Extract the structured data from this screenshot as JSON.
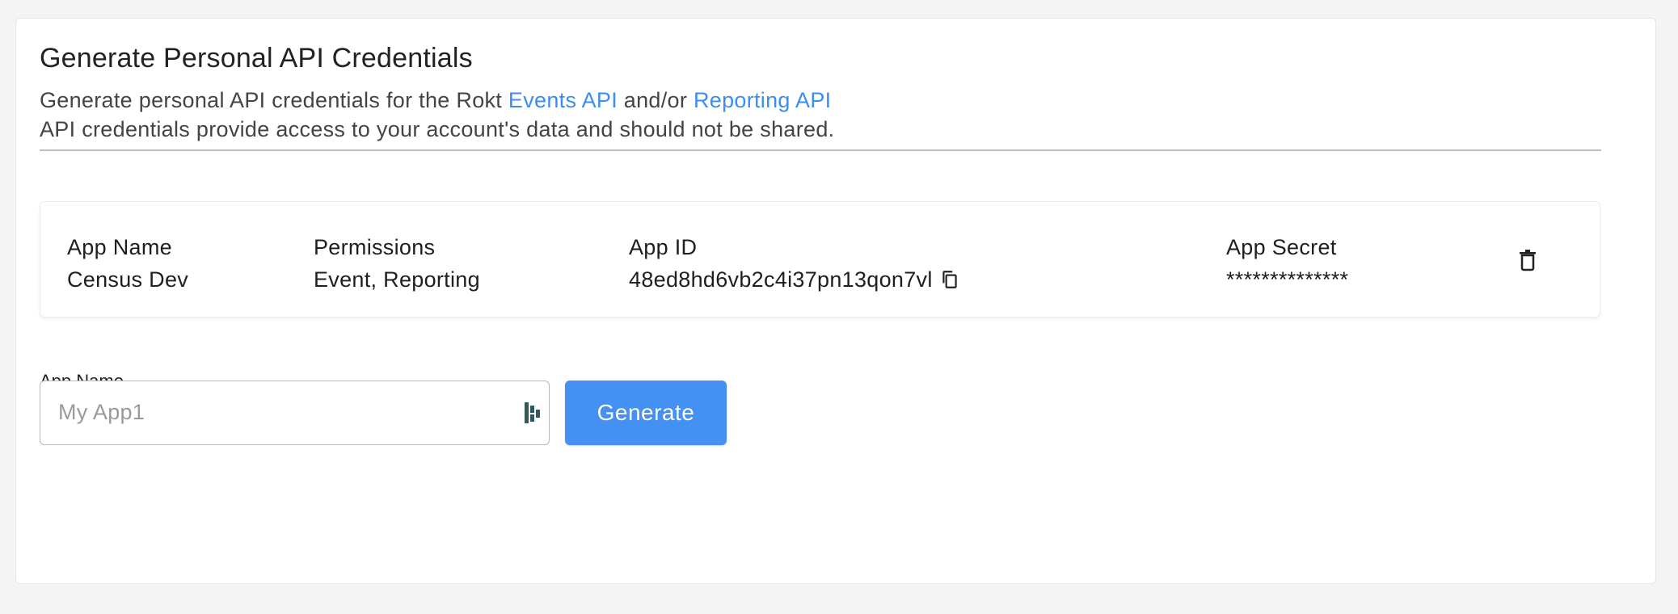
{
  "header": {
    "title": "Generate Personal API Credentials",
    "desc_prefix": "Generate personal API credentials for the Rokt ",
    "events_api_link": "Events API",
    "desc_middle": " and/or ",
    "reporting_api_link": "Reporting API",
    "desc_line2": "API credentials provide access to your account's data and should not be shared."
  },
  "credentials": [
    {
      "app_name_label": "App Name",
      "app_name": "Census Dev",
      "permissions_label": "Permissions",
      "permissions": "Event, Reporting",
      "app_id_label": "App ID",
      "app_id": "48ed8hd6vb2c4i37pn13qon7vl",
      "app_secret_label": "App Secret",
      "app_secret": "**************"
    }
  ],
  "form": {
    "app_name_label": "App Name",
    "app_name_placeholder": "My App1",
    "app_name_value": "",
    "generate_label": "Generate"
  },
  "icons": {
    "copy": "copy-icon",
    "delete": "trash-icon",
    "input_extension": "extension-icon"
  },
  "colors": {
    "link": "#3b8ef0",
    "primary_button": "#4490f3"
  }
}
